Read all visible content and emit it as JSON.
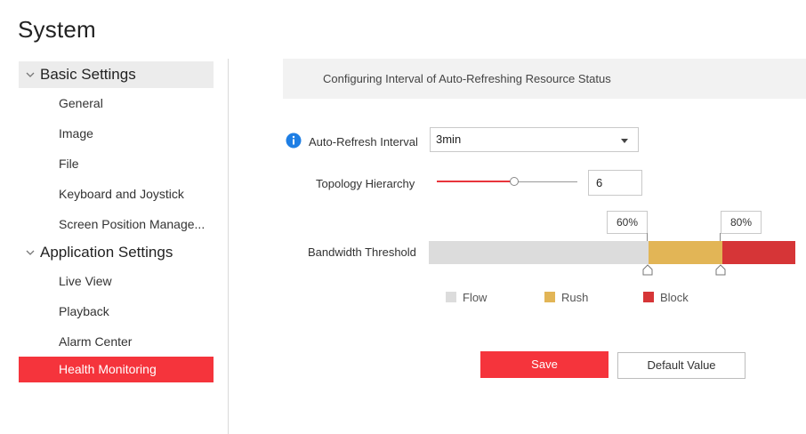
{
  "page": {
    "title": "System"
  },
  "sidebar": {
    "groups": [
      {
        "label": "Basic Settings",
        "items": [
          "General",
          "Image",
          "File",
          "Keyboard and Joystick",
          "Screen Position Manage..."
        ]
      },
      {
        "label": "Application Settings",
        "items": [
          "Live View",
          "Playback",
          "Alarm Center",
          "Health Monitoring"
        ]
      }
    ],
    "active_item": "Health Monitoring"
  },
  "section": {
    "title": "Configuring Interval of Auto-Refreshing Resource Status"
  },
  "auto_refresh": {
    "label": "Auto-Refresh Interval",
    "value": "3min",
    "icon": "info-icon"
  },
  "topology": {
    "label": "Topology Hierarchy",
    "value": "6",
    "slider_fraction": 0.55
  },
  "bandwidth": {
    "label": "Bandwidth Threshold",
    "rush_threshold": "60%",
    "block_threshold": "80%",
    "segments": [
      {
        "name": "Flow",
        "fraction": 0.6,
        "color": "#dcdcdc"
      },
      {
        "name": "Rush",
        "fraction": 0.2,
        "color": "#e2b556"
      },
      {
        "name": "Block",
        "fraction": 0.2,
        "color": "#d63537"
      }
    ]
  },
  "legend": {
    "flow": {
      "label": "Flow",
      "color": "#dcdcdc"
    },
    "rush": {
      "label": "Rush",
      "color": "#e2b556"
    },
    "block": {
      "label": "Block",
      "color": "#d63537"
    }
  },
  "buttons": {
    "save": "Save",
    "default": "Default Value"
  },
  "colors": {
    "accent": "#f5343c",
    "info": "#1e7ee4"
  }
}
